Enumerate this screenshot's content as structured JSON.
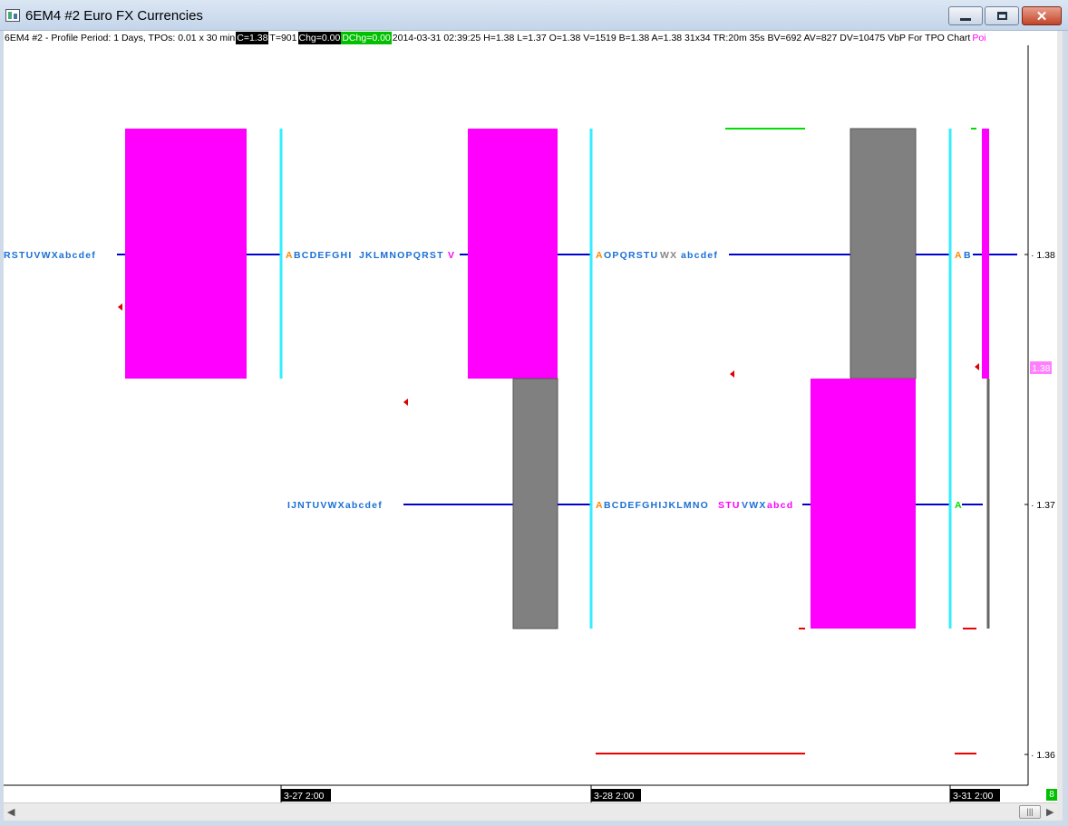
{
  "window": {
    "title": "6EM4  #2  Euro FX Currencies",
    "close_glyph": "✕"
  },
  "info_bar": {
    "prefix": "6EM4  #2 - Profile Period: 1 Days, TPOs: 0.01 x 30 min",
    "close": "C=1.38",
    "ticks": "T=901",
    "change": "Chg=0.00",
    "dchange": "DChg=0.00",
    "details": "2014-03-31 02:39:25 H=1.38 L=1.37 O=1.38 V=1519 B=1.38 A=1.38 31x34 TR:20m 35s BV=692 AV=827 DV=10475 VbP For TPO Chart",
    "point": "Poi"
  },
  "colors": {
    "magenta": "#ff00ff",
    "gray": "#808080",
    "cyan": "#33eeff",
    "blue": "#0000cc",
    "red": "#ee0000",
    "green": "#00dd00",
    "letters_blue": "#1a6fd6",
    "orange": "#ff8800"
  },
  "price_axis": {
    "labels": [
      "1.38",
      "1.37",
      "1.36"
    ],
    "current_price": "1.38"
  },
  "time_axis": {
    "labels": [
      "3-27  2:00",
      "3-28  2:00",
      "3-31  2:00"
    ]
  },
  "tpo_rows": {
    "r1_seg1": "RSTUVWXabcdef",
    "r1_seg2_first": "A",
    "r1_seg2": "BCDEFGHI",
    "r1_seg2b": "JKLMNOPQRST",
    "r1_seg2_last": "V",
    "r1_seg3_first": "A",
    "r1_seg3": "OPQRSTU",
    "r1_seg3b": "WX",
    "r1_seg3c": "abcdef",
    "r1_seg4_first": "A",
    "r1_seg4": "B",
    "r2_seg1": "IJNTUVWXabcdef",
    "r2_seg2_first": "A",
    "r2_seg2": "BCDEFGHIJKLMNO",
    "r2_seg2b": "STU",
    "r2_seg2c": "VWX",
    "r2_seg2d": "abcd",
    "r2_seg3_first": "A"
  },
  "status": {
    "indicator": "8"
  }
}
